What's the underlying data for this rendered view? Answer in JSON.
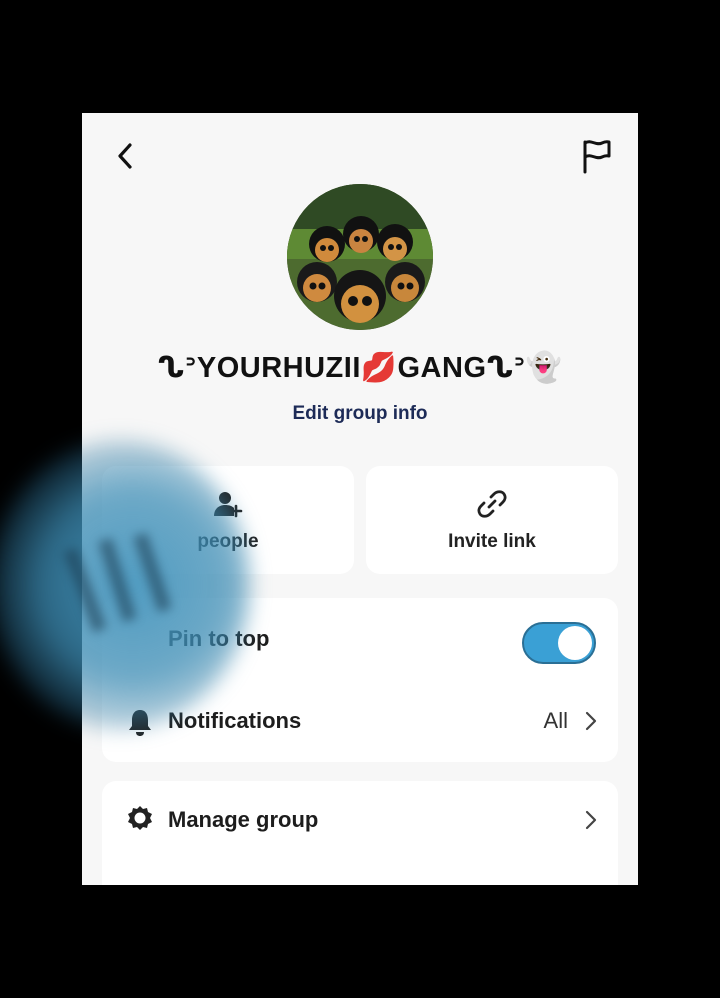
{
  "header": {
    "back_icon": "chevron-left-icon",
    "report_icon": "flag-icon"
  },
  "group": {
    "name": "ᔐᐣYOURHUZII💋GANGᔐᐣ👻",
    "edit_label": "Edit group info"
  },
  "actions": [
    {
      "label": "people",
      "icon": "add-person-icon"
    },
    {
      "label": "Invite link",
      "icon": "link-icon"
    }
  ],
  "settings": {
    "pin_label": "Pin to top",
    "pin_enabled": true,
    "notifications_label": "Notifications",
    "notifications_value": "All",
    "notifications_icon": "bell-icon",
    "manage_label": "Manage group",
    "manage_icon": "gear-icon"
  },
  "colors": {
    "accent": "#3aa0d5",
    "edit_link": "#1d2b57",
    "background": "#f7f7f7",
    "card": "#ffffff"
  }
}
